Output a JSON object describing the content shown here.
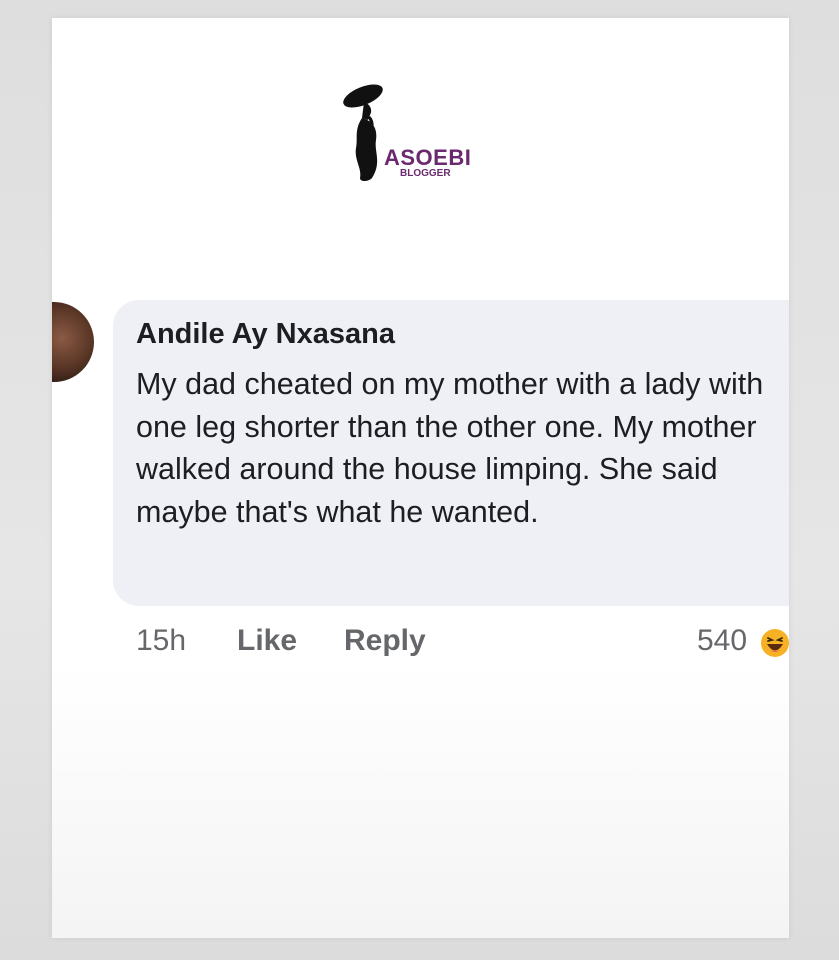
{
  "logo": {
    "brand": "ASOEBI",
    "sub": "BLOGGER"
  },
  "comment": {
    "author": "Andile Ay Nxasana",
    "text": "My dad cheated on my mother with a lady with one leg shorter than the other one. My mother walked around the house limping. She said maybe that's what he wanted.",
    "time": "15h",
    "like_label": "Like",
    "reply_label": "Reply",
    "reaction_count": "540",
    "reaction_icon": "haha-emoji-icon"
  },
  "colors": {
    "bubble": "#eff0f5",
    "text": "#1c1e21",
    "meta": "#65676b",
    "brand": "#6b2a6f",
    "emoji": "#f7b125"
  }
}
